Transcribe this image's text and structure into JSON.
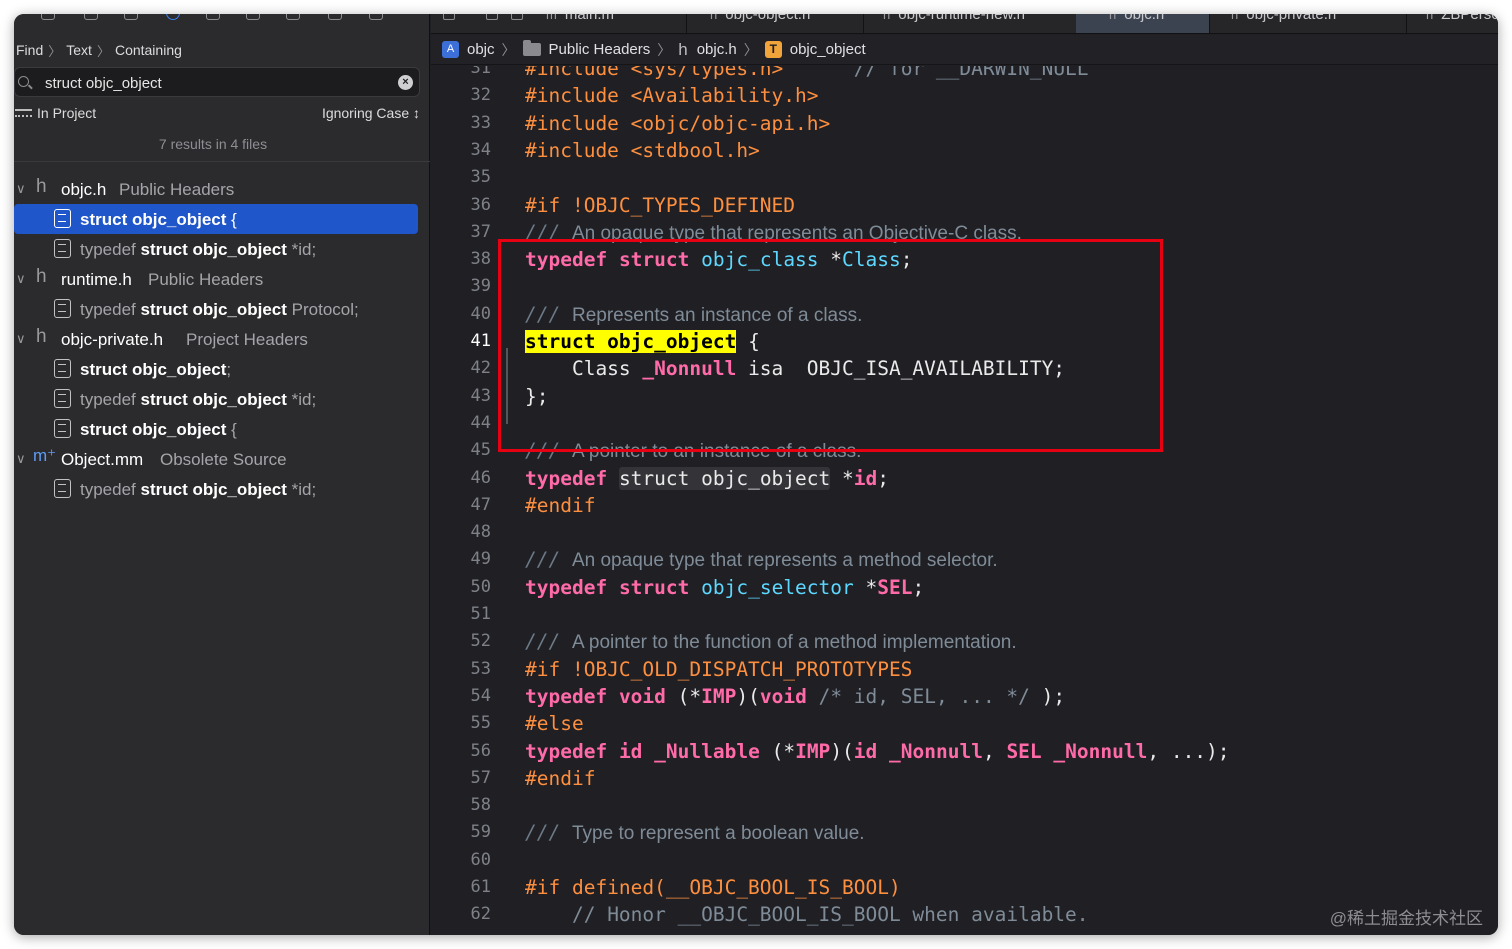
{
  "find": {
    "breadcrumb": [
      "Find",
      "Text",
      "Containing"
    ],
    "query": "struct objc_object",
    "scope": "In Project",
    "case_mode": "Ignoring Case ↕",
    "summary": "7 results in 4 files"
  },
  "results": [
    {
      "kind": "file",
      "icon": "header-file-icon",
      "name": "objc.h",
      "group": "Public Headers"
    },
    {
      "kind": "match",
      "pre": "",
      "hit": "struct objc_object",
      "post": " {",
      "selected": true
    },
    {
      "kind": "match",
      "pre": "typedef ",
      "hit": "struct objc_object",
      "post": " *id;"
    },
    {
      "kind": "file",
      "icon": "header-file-icon",
      "name": "runtime.h",
      "group": "Public Headers"
    },
    {
      "kind": "match",
      "pre": "typedef ",
      "hit": "struct objc_object",
      "post": " Protocol;"
    },
    {
      "kind": "file",
      "icon": "header-file-icon",
      "name": "objc-private.h",
      "group": "Project Headers"
    },
    {
      "kind": "match",
      "pre": "",
      "hit": "struct objc_object",
      "post": ";"
    },
    {
      "kind": "match",
      "pre": "typedef ",
      "hit": "struct objc_object",
      "post": " *id;"
    },
    {
      "kind": "match",
      "pre": "",
      "hit": "struct objc_object",
      "post": " {"
    },
    {
      "kind": "file",
      "icon": "objc-mm-file-icon",
      "name": "Object.mm",
      "group": "Obsolete Source"
    },
    {
      "kind": "match",
      "pre": "typedef ",
      "hit": "struct objc_object",
      "post": " *id;"
    }
  ],
  "tabs": [
    {
      "label": "main.m"
    },
    {
      "label": "objc-object.h"
    },
    {
      "label": "objc-runtime-new.h"
    },
    {
      "label": "objc.h",
      "active": true
    },
    {
      "label": "objc-private.h"
    },
    {
      "label": "ZBPerso"
    }
  ],
  "jump_bar": [
    {
      "icon": "project-icon",
      "label": "objc"
    },
    {
      "icon": "folder-icon",
      "label": "Public Headers"
    },
    {
      "icon": "header-file-icon",
      "label": "objc.h"
    },
    {
      "icon": "type-symbol-icon",
      "label": "objc_object"
    }
  ],
  "current_line": 41,
  "code_lines": [
    {
      "n": 31,
      "t": [
        [
          "pp",
          "#include <sys/types.h>"
        ],
        [
          "plain",
          "      "
        ],
        [
          "codecomment",
          "// for __DARWIN_NULL"
        ]
      ]
    },
    {
      "n": 32,
      "t": [
        [
          "pp",
          "#include <Availability.h>"
        ]
      ]
    },
    {
      "n": 33,
      "t": [
        [
          "pp",
          "#include <objc/objc-api.h>"
        ]
      ]
    },
    {
      "n": 34,
      "t": [
        [
          "pp",
          "#include <stdbool.h>"
        ]
      ]
    },
    {
      "n": 35,
      "t": []
    },
    {
      "n": 36,
      "t": [
        [
          "pp",
          "#if !OBJC_TYPES_DEFINED"
        ]
      ]
    },
    {
      "n": 37,
      "t": [
        [
          "cmark",
          "/// "
        ],
        [
          "comment",
          "An opaque type that represents an Objective-C class."
        ]
      ]
    },
    {
      "n": 38,
      "t": [
        [
          "kw",
          "typedef"
        ],
        [
          "plain",
          " "
        ],
        [
          "kw",
          "struct"
        ],
        [
          "plain",
          " "
        ],
        [
          "type",
          "objc_class"
        ],
        [
          "plain",
          " *"
        ],
        [
          "type",
          "Class"
        ],
        [
          "plain",
          ";"
        ]
      ]
    },
    {
      "n": 39,
      "t": []
    },
    {
      "n": 40,
      "t": [
        [
          "cmark",
          "/// "
        ],
        [
          "comment",
          "Represents an instance of a class."
        ]
      ]
    },
    {
      "n": 41,
      "t": [
        [
          "hl",
          "struct objc_object"
        ],
        [
          "plain",
          " {"
        ]
      ]
    },
    {
      "n": 42,
      "t": [
        [
          "plain",
          "    Class "
        ],
        [
          "nonnull",
          "_Nonnull"
        ],
        [
          "plain",
          " isa  OBJC_ISA_AVAILABILITY;"
        ]
      ]
    },
    {
      "n": 43,
      "t": [
        [
          "plain",
          "};"
        ]
      ]
    },
    {
      "n": 44,
      "t": []
    },
    {
      "n": 45,
      "t": [
        [
          "cmark",
          "/// "
        ],
        [
          "comment",
          "A pointer to an instance of a class."
        ]
      ]
    },
    {
      "n": 46,
      "t": [
        [
          "kw",
          "typedef"
        ],
        [
          "plain",
          " "
        ],
        [
          "outlined",
          "struct objc_object"
        ],
        [
          "plain",
          " *"
        ],
        [
          "kw",
          "id"
        ],
        [
          "plain",
          ";"
        ]
      ]
    },
    {
      "n": 47,
      "t": [
        [
          "pp",
          "#endif"
        ]
      ]
    },
    {
      "n": 48,
      "t": []
    },
    {
      "n": 49,
      "t": [
        [
          "cmark",
          "/// "
        ],
        [
          "comment",
          "An opaque type that represents a method selector."
        ]
      ]
    },
    {
      "n": 50,
      "t": [
        [
          "kw",
          "typedef"
        ],
        [
          "plain",
          " "
        ],
        [
          "kw",
          "struct"
        ],
        [
          "plain",
          " "
        ],
        [
          "type",
          "objc_selector"
        ],
        [
          "plain",
          " *"
        ],
        [
          "kw",
          "SEL"
        ],
        [
          "plain",
          ";"
        ]
      ]
    },
    {
      "n": 51,
      "t": []
    },
    {
      "n": 52,
      "t": [
        [
          "cmark",
          "/// "
        ],
        [
          "comment",
          "A pointer to the function of a method implementation."
        ]
      ]
    },
    {
      "n": 53,
      "t": [
        [
          "pp",
          "#if !OBJC_OLD_DISPATCH_PROTOTYPES"
        ]
      ]
    },
    {
      "n": 54,
      "t": [
        [
          "kw",
          "typedef"
        ],
        [
          "plain",
          " "
        ],
        [
          "kw",
          "void"
        ],
        [
          "plain",
          " (*"
        ],
        [
          "kw",
          "IMP"
        ],
        [
          "plain",
          ")("
        ],
        [
          "kw",
          "void"
        ],
        [
          "plain",
          " "
        ],
        [
          "codecomment",
          "/* id, SEL, ... */"
        ],
        [
          "plain",
          " );"
        ]
      ]
    },
    {
      "n": 55,
      "t": [
        [
          "pp",
          "#else"
        ]
      ]
    },
    {
      "n": 56,
      "t": [
        [
          "kw",
          "typedef"
        ],
        [
          "plain",
          " "
        ],
        [
          "kw",
          "id"
        ],
        [
          "plain",
          " "
        ],
        [
          "nonnull",
          "_Nullable"
        ],
        [
          "plain",
          " (*"
        ],
        [
          "kw",
          "IMP"
        ],
        [
          "plain",
          ")("
        ],
        [
          "kw",
          "id"
        ],
        [
          "plain",
          " "
        ],
        [
          "nonnull",
          "_Nonnull"
        ],
        [
          "plain",
          ", "
        ],
        [
          "kw",
          "SEL"
        ],
        [
          "plain",
          " "
        ],
        [
          "nonnull",
          "_Nonnull"
        ],
        [
          "plain",
          ", ...);"
        ]
      ]
    },
    {
      "n": 57,
      "t": [
        [
          "pp",
          "#endif"
        ]
      ]
    },
    {
      "n": 58,
      "t": []
    },
    {
      "n": 59,
      "t": [
        [
          "cmark",
          "/// "
        ],
        [
          "comment",
          "Type to represent a boolean value."
        ]
      ]
    },
    {
      "n": 60,
      "t": []
    },
    {
      "n": 61,
      "t": [
        [
          "pp",
          "#if defined(__OBJC_BOOL_IS_BOOL)"
        ]
      ]
    },
    {
      "n": 62,
      "t": [
        [
          "plain",
          "    "
        ],
        [
          "codecomment",
          "// Honor __OBJC_BOOL_IS_BOOL when available."
        ]
      ]
    }
  ],
  "annotation_color": "#e60012",
  "watermark": "@稀土掘金技术社区"
}
